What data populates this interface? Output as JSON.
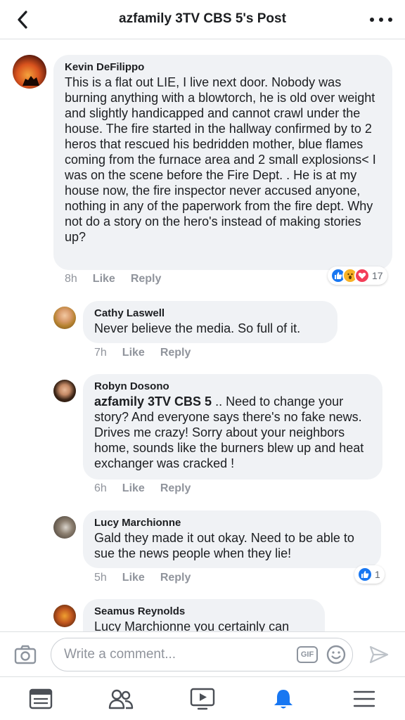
{
  "header": {
    "title": "azfamily 3TV CBS 5's Post"
  },
  "comments": [
    {
      "author": "Kevin DeFilippo",
      "text": "This is a flat out LIE, I live next door. Nobody was burning anything with a blowtorch, he is old over weight and slightly handicapped and cannot crawl under the house. The fire started in the hallway confirmed by to 2 heros that rescued his bedridden mother, blue flames coming from the furnace area and 2 small explosions< I was on the scene before the Fire Dept. . He is at my house now, the fire inspector never accused anyone, nothing in any of the paperwork from the fire dept. Why not do a story on the hero's instead of making stories up?",
      "time": "8h",
      "reaction_count": "17"
    },
    {
      "author": "Cathy Laswell",
      "text": "Never believe the media. So full of it.",
      "time": "7h"
    },
    {
      "author": "Robyn Dosono",
      "mention": "azfamily 3TV CBS 5",
      "text": " .. Need to change your story? And everyone says there's no fake news. Drives me crazy! Sorry about your neighbors home, sounds like the burners blew up and heat exchanger was cracked !",
      "time": "6h"
    },
    {
      "author": "Lucy Marchionne",
      "text": "Gald they made it out okay. Need to be able to sue the news people when they lie!",
      "time": "5h",
      "reaction_count": "1"
    },
    {
      "author": "Seamus Reynolds",
      "text": "Lucy Marchionne you certainly can"
    }
  ],
  "actions": {
    "like": "Like",
    "reply": "Reply"
  },
  "composer": {
    "placeholder": "Write a comment...",
    "gif_label": "GIF"
  },
  "icons": {
    "back": "chevron-left-icon",
    "more": "more-horizontal-icon",
    "camera": "camera-icon",
    "emoji": "emoji-icon",
    "send": "send-icon",
    "tabs": [
      "news-feed-icon",
      "friends-icon",
      "watch-icon",
      "notifications-icon",
      "menu-icon"
    ]
  },
  "colors": {
    "accent": "#1877f2",
    "love": "#f33e58",
    "wow": "#f7b125",
    "bubble": "#f0f2f5",
    "meta": "#90949c"
  }
}
